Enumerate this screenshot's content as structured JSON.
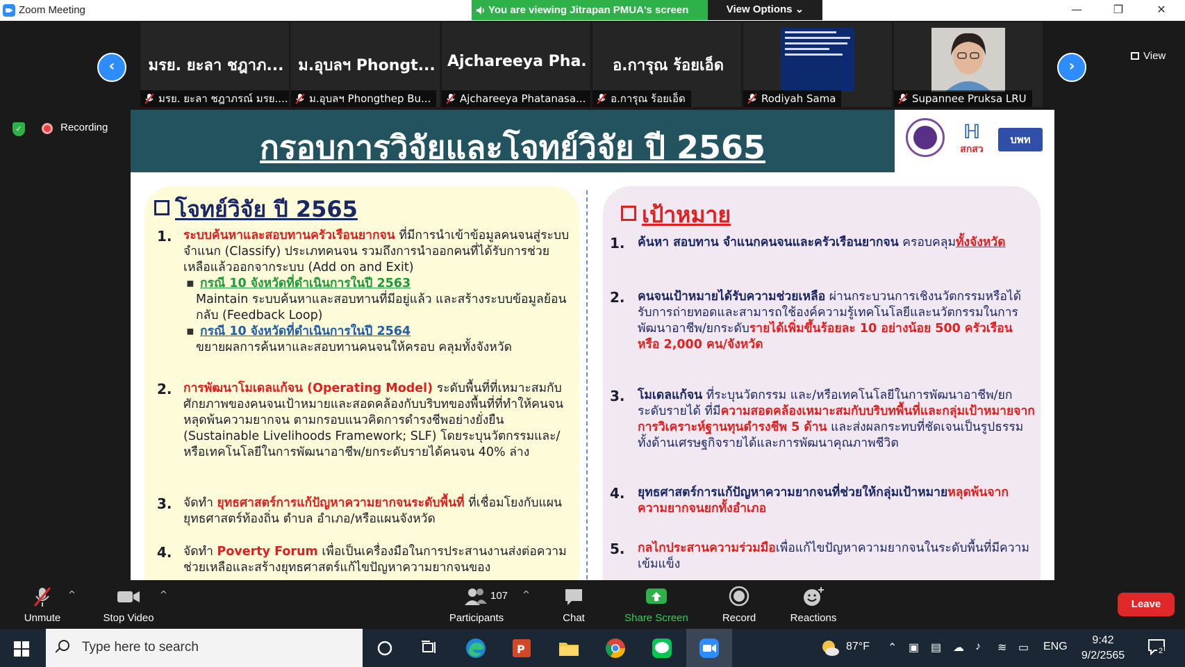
{
  "window": {
    "title": "Zoom Meeting",
    "viewing_banner": "You are viewing Jitrapan PMUA's screen",
    "view_options": "View Options ⌄",
    "minimize": "—",
    "restore": "❐",
    "close": "✕"
  },
  "strip": {
    "prev": "‹",
    "next": "›",
    "view_label": "View",
    "tiles": [
      {
        "bigname": "มรย. ยะลา ชฎาภ...",
        "caption": "มรย. ยะลา ชฎาภรณ์ มรย...."
      },
      {
        "bigname": "ม.อุบลฯ Phongt...",
        "caption": "ม.อุบลฯ Phongthep Bu..."
      },
      {
        "bigname": "Ajchareeya  Pha...",
        "caption": "Ajchareeya Phatanasa..."
      },
      {
        "bigname": "อ.การุณ ร้อยเอ็ด",
        "caption": "อ.การุณ ร้อยเอ็ด"
      },
      {
        "bigname": "",
        "caption": "Rodiyah Sama"
      },
      {
        "bigname": "",
        "caption": "Supannee Pruksa LRU"
      }
    ]
  },
  "status": {
    "shield": "✓",
    "recording": "Recording"
  },
  "slide": {
    "title": "กรอบการวิจัยและโจทย์วิจัย ปี 2565",
    "logo_mark": "ℍ",
    "logo_text": "สกสว",
    "logo3_text": "บพท",
    "left": {
      "heading": "โจทย์วิจัย ปี 2565",
      "items": [
        {
          "num": "1.",
          "red": "ระบบค้นหาและสอบทานครัวเรือนยากจน",
          "text": " ที่มีการนำเข้าข้อมูลคนจนสู่ระบบจำแนก (Classify) ประเภทคนจน รวมถึงการนำออกคนที่ได้รับการช่วยเหลือแล้วออกจากระบบ (Add on and Exit)",
          "sub1_link": "กรณี 10 จังหวัดที่ดำเนินการในปี 2563",
          "sub1_text": "Maintain ระบบค้นหาและสอบทานที่มีอยู่แล้ว และสร้างระบบข้อมูลย้อนกลับ (Feedback Loop)",
          "sub2_link": "กรณี 10 จังหวัดที่ดำเนินการในปี 2564",
          "sub2_text": "ขยายผลการค้นหาและสอบทานคนจนให้ครอบ คลุมทั้งจังหวัด"
        },
        {
          "num": "2.",
          "red": "การพัฒนาโมเดลแก้จน (Operating      Model)",
          "text": " ระดับพื้นที่ที่เหมาะสมกับศักยภาพของคนจนเป้าหมายและสอดคล้องกับบริบทของพื้นที่ที่ทำให้คนจนหลุดพ้นความยากจน ตามกรอบแนวคิดการดำรงชีพอย่างยั่งยืน (Sustainable Livelihoods Framework; SLF) โดยระบุนวัตกรรมและ/หรือเทคโนโลยีในการพัฒนาอาชีพ/ยกระดับรายได้คนจน 40% ล่าง"
        },
        {
          "num": "3.",
          "pre": "จัดทำ ",
          "red": "ยุทธศาสตร์การแก้ปัญหาความยากจนระดับพื้นที่",
          "text": " ที่เชื่อมโยงกับแผนยุทธศาสตร์ท้องถิ่น ตำบล อำเภอ/หรือแผนจังหวัด"
        },
        {
          "num": "4.",
          "pre": "จัดทำ ",
          "red": "Poverty Forum",
          "text": " เพื่อเป็นเครื่องมือในการประสานงานส่งต่อความช่วยเหลือและสร้างยุทธศาสตร์แก้ไขปัญหาความยากจนของ"
        }
      ]
    },
    "right": {
      "heading": "เป้าหมาย",
      "items": [
        {
          "num": "1.",
          "navy": "ค้นหา สอบทาน จำแนกคนจนและครัวเรือนยากจน",
          "text": " ครอบคลุม",
          "red_ul": "ทั้งจังหวัด"
        },
        {
          "num": "2.",
          "navy": "คนจนเป้าหมายได้รับความช่วยเหลือ",
          "text": " ผ่านกระบวนการเชิงนวัตกรรมหรือได้รับการถ่ายทอดและสามารถใช้องค์ความรู้เทคโนโลยีและนวัตกรรมในการพัฒนาอาชีพ/ยกระดับ",
          "red": "รายได้เพิ่มขึ้นร้อยละ 10 อย่างน้อย 500 ครัวเรือน หรือ 2,000 คน/จังหวัด"
        },
        {
          "num": "3.",
          "navy": "โมเดลแก้จน",
          "text": " ที่ระบุนวัตกรรม และ/หรือเทคโนโลยีในการพัฒนาอาชีพ/ยกระดับรายได้ ที่มี",
          "red": "ความสอดคล้องเหมาะสมกับบริบทพื้นที่และกลุ่มเป้าหมายจากการวิเคราะห์ฐานทุนดำรงชีพ 5 ด้าน",
          "text2": " และส่งผลกระทบที่ชัดเจนเป็นรูปธรรม ทั้งด้านเศรษฐกิจรายได้และการพัฒนาคุณภาพชีวิต"
        },
        {
          "num": "4.",
          "navy": "ยุทธศาสตร์การแก้ปัญหาความยากจนที่ช่วยให้กลุ่มเป้าหมาย",
          "red": "หลุดพ้นจากความยากจนยกทั้งอำเภอ"
        },
        {
          "num": "5.",
          "red": "กลไกประสานความร่วมมือ",
          "text": "เพื่อแก้ไขปัญหาความยากจนในระดับพื้นที่มีความเข้มแข็ง"
        }
      ]
    }
  },
  "toolbar": {
    "unmute": "Unmute",
    "stop_video": "Stop Video",
    "participants": "Participants",
    "participants_count": "107",
    "chat": "Chat",
    "share_screen": "Share Screen",
    "record": "Record",
    "reactions": "Reactions",
    "leave": "Leave",
    "caret": "^"
  },
  "taskbar": {
    "search_placeholder": "Type here to search",
    "weather": "87°F",
    "lang": "ENG",
    "time": "9:42",
    "date": "9/2/2565",
    "notif_count": "2"
  },
  "colors": {
    "zoom_blue": "#2d8cff",
    "banner_green": "#2fb14a",
    "leave_red": "#e02828",
    "slide_header": "#23535f",
    "slide_red": "#e01f1f",
    "slide_navy": "#1a2766"
  }
}
